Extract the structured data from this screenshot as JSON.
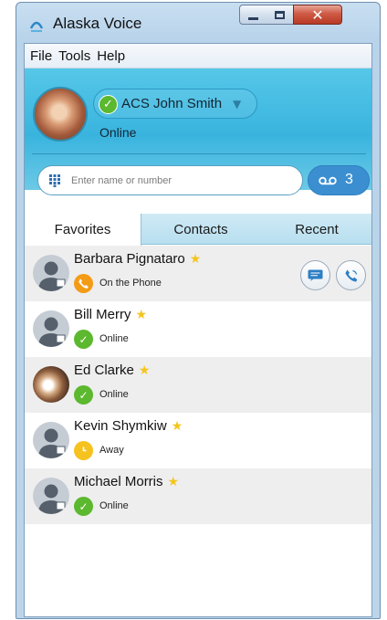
{
  "window": {
    "title": "Alaska Voice",
    "close_glyph": "✕"
  },
  "menu": [
    "File",
    "Tools",
    "Help"
  ],
  "profile": {
    "name": "ACS John Smith",
    "status": "Online",
    "status_glyph": "✓",
    "caret": "▼"
  },
  "search": {
    "placeholder": "Enter name or number",
    "value": ""
  },
  "voicemail": {
    "count": "3"
  },
  "tabs": [
    "Favorites",
    "Contacts",
    "Recent"
  ],
  "icons": {
    "star": "★",
    "online": "✓",
    "away": "clock-icon",
    "phone": "phone-icon"
  },
  "contacts": [
    {
      "name": "Barbara Pignataro",
      "status": "On the Phone",
      "state": "phone",
      "favorite": true,
      "avatar": "placeholder"
    },
    {
      "name": "Bill Merry",
      "status": "Online",
      "state": "online",
      "favorite": true,
      "avatar": "placeholder"
    },
    {
      "name": "Ed Clarke",
      "status": "Online",
      "state": "online",
      "favorite": true,
      "avatar": "photo"
    },
    {
      "name": "Kevin Shymkiw",
      "status": "Away",
      "state": "away",
      "favorite": true,
      "avatar": "placeholder"
    },
    {
      "name": "Michael Morris",
      "status": "Online",
      "state": "online",
      "favorite": true,
      "avatar": "placeholder"
    }
  ],
  "colors": {
    "accent": "#39b4de",
    "voicemail": "#3b8fd1",
    "online": "#5cb82e",
    "away": "#f6c21f",
    "on_phone": "#f49b16",
    "star": "#f5c51c"
  }
}
